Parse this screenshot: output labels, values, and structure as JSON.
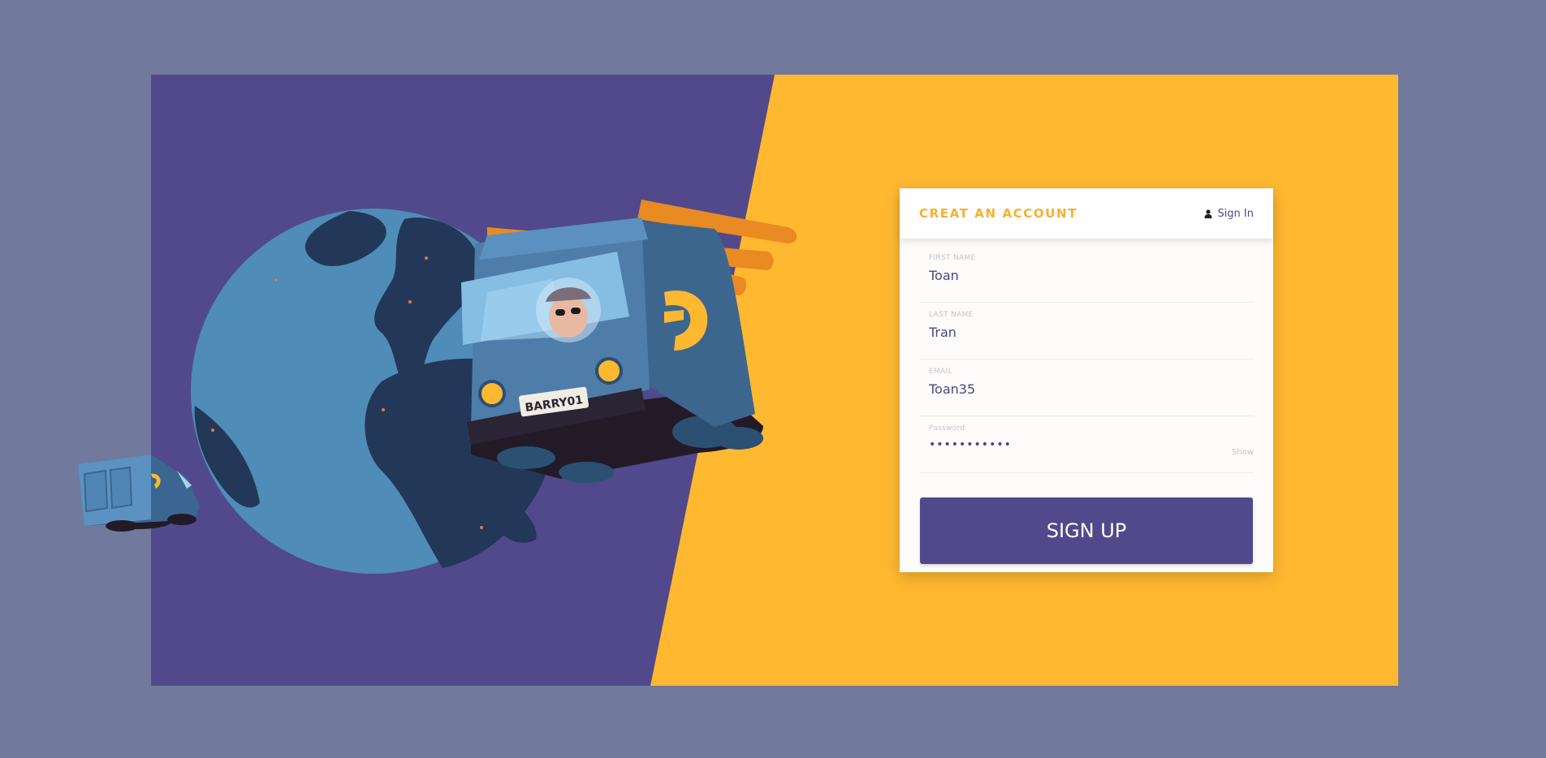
{
  "form": {
    "title": "CREAT AN ACCOUNT",
    "signin_label": "Sign In",
    "fields": [
      {
        "label": "FIRST NAME",
        "value": "Toan"
      },
      {
        "label": "LAST NAME",
        "value": "Tran"
      },
      {
        "label": "EMAIL",
        "value": "Toan35"
      },
      {
        "label": "Password",
        "value": "•••••••••••",
        "toggle": "Show"
      }
    ],
    "submit_label": "SIGN UP"
  },
  "illustration": {
    "plate_text": "BARRY01"
  },
  "colors": {
    "background": "#717a9d",
    "purple": "#51498b",
    "yellow": "#ffb830",
    "title_accent": "#f7b02f"
  },
  "icons": {
    "signin": "user-icon",
    "truck_logo": "truck-logo-icon"
  }
}
